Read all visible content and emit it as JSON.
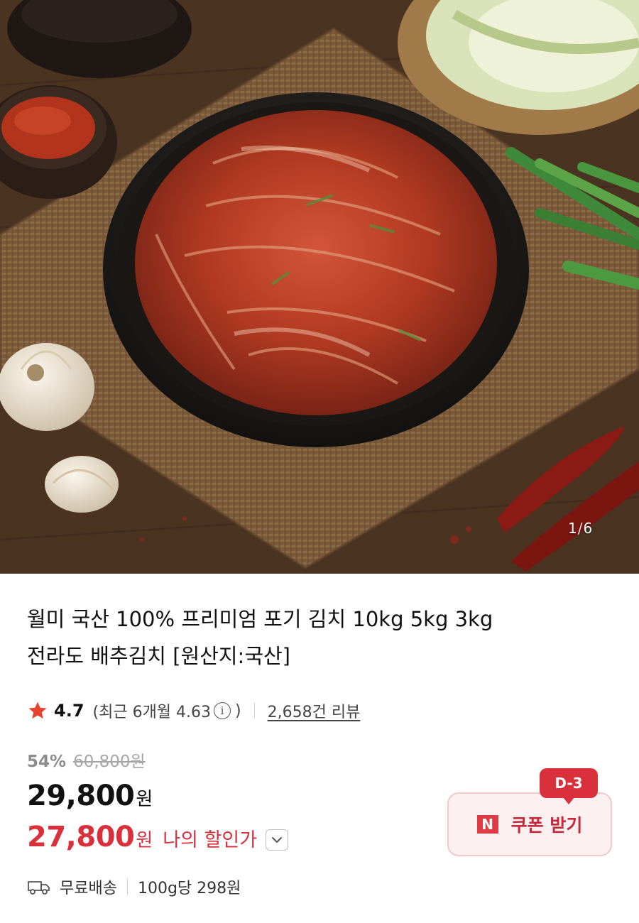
{
  "gallery": {
    "current": "1",
    "separator": "/",
    "total": "6"
  },
  "product": {
    "title_line1": "월미 국산 100% 프리미엄 포기 김치 10kg 5kg 3kg",
    "title_line2": "전라도 배추김치 [원산지:국산]"
  },
  "rating": {
    "star_icon": "star-icon",
    "value": "4.7",
    "recent_prefix": "(최근 6개월 4.63",
    "recent_suffix": ")",
    "info_icon_glyph": "i",
    "review_link": "2,658건 리뷰"
  },
  "price": {
    "discount_rate": "54%",
    "original_price": "60,800원",
    "sale_price": "29,800",
    "currency": "원",
    "my_price": "27,800",
    "my_price_label": "나의 할인가"
  },
  "coupon": {
    "dday": "D-3",
    "logo_letter": "N",
    "label": "쿠폰 받기"
  },
  "shipping": {
    "free_shipping": "무료배송",
    "unit_price": "100g당 298원"
  },
  "colors": {
    "accent_red": "#d9303c",
    "coupon_bg": "#fdf0f0",
    "star": "#e8432e"
  }
}
